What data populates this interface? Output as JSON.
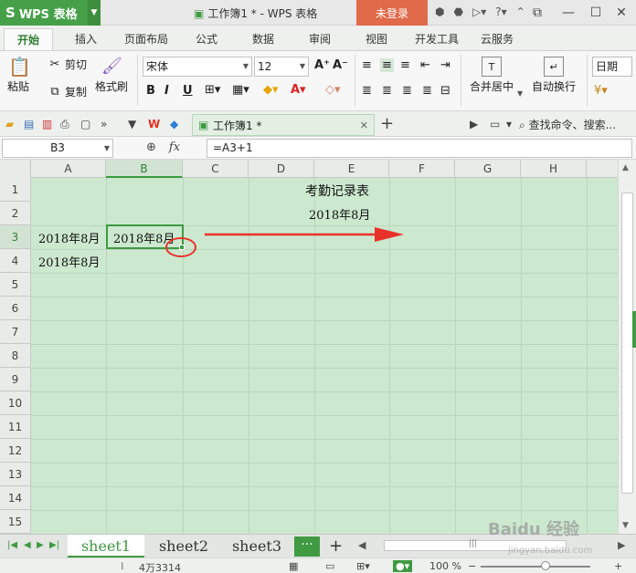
{
  "app": {
    "name": "WPS 表格",
    "logo": "S",
    "doc_title": "工作簿1 * - WPS 表格",
    "login": "未登录"
  },
  "ribbon_tabs": [
    "开始",
    "插入",
    "页面布局",
    "公式",
    "数据",
    "审阅",
    "视图",
    "开发工具",
    "云服务"
  ],
  "ribbon": {
    "paste": "粘贴",
    "cut": "剪切",
    "copy": "复制",
    "format_painter": "格式刷",
    "font_name": "宋体",
    "font_size": "12",
    "merge_center": "合并居中",
    "wrap_text": "自动换行",
    "number_format": "日期"
  },
  "doc_tab": {
    "label": "工作簿1 *",
    "search": "查找命令、搜索..."
  },
  "formula_bar": {
    "name_box": "B3",
    "formula": "=A3+1"
  },
  "columns": [
    "A",
    "B",
    "C",
    "D",
    "E",
    "F",
    "G",
    "H"
  ],
  "rows": [
    "1",
    "2",
    "3",
    "4",
    "5",
    "6",
    "7",
    "8",
    "9",
    "10",
    "11",
    "12",
    "13",
    "14",
    "15"
  ],
  "cells": {
    "title": "考勤记录表",
    "month": "2018年8月",
    "a3": "2018年8月",
    "b3": "2018年8月",
    "a4": "2018年8月"
  },
  "selected": {
    "column": "B",
    "row": "3"
  },
  "sheets": [
    "sheet1",
    "sheet2",
    "sheet3"
  ],
  "active_sheet": "sheet1",
  "status": {
    "count": "4万3314",
    "zoom": "100 %"
  },
  "watermark": {
    "text": "Baidu 经验",
    "sub": "jingyan.baidu.com"
  },
  "colors": {
    "accent": "#3f9a42",
    "grid_bg": "#cce8cf",
    "login": "#e06a4a",
    "annotation": "#e8322a"
  }
}
